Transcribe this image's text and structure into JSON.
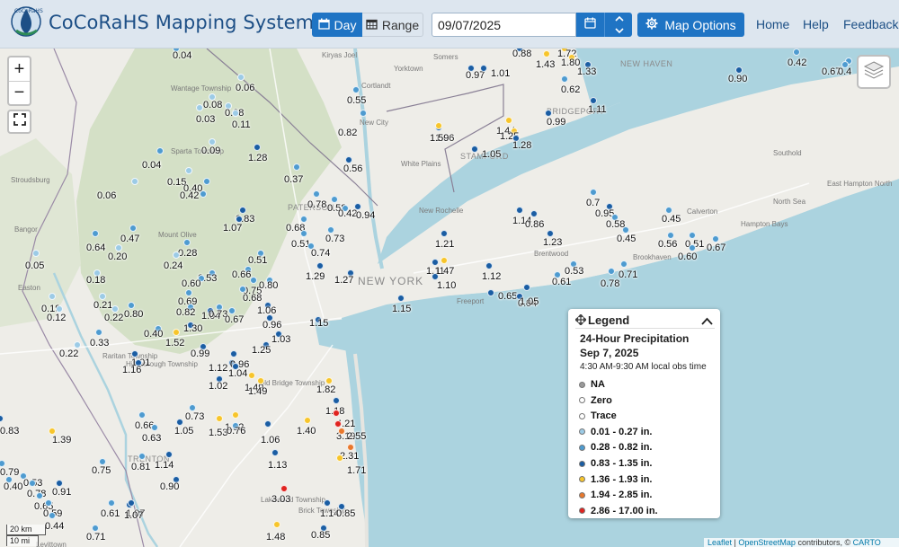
{
  "header": {
    "title": "CoCoRaHS Mapping System",
    "logo_text": "CoCoRaHS",
    "day_label": "Day",
    "range_label": "Range",
    "date_value": "09/07/2025",
    "map_options_label": "Map Options",
    "nav": [
      "Home",
      "Help",
      "Feedback"
    ]
  },
  "colors": {
    "accent": "#1f74c4",
    "water": "#abd3df",
    "land": "#eeede8",
    "county_green": "#d4e0c6",
    "na": "#9a9a9a",
    "zero": "#ffffff",
    "trace": "#ffffff",
    "bin1": "#9ccbe6",
    "bin2": "#4e9bd0",
    "bin3": "#1a5da3",
    "bin4": "#f7c52b",
    "bin5": "#e8782d",
    "bin6": "#e0231f"
  },
  "icons": {
    "day": "calendar-day-icon",
    "range": "calendar-range-icon",
    "calendar": "calendar-icon",
    "up": "chevron-up-icon",
    "down": "chevron-down-icon",
    "options": "gear-icon",
    "zoom_in": "plus-icon",
    "zoom_out": "minus-icon",
    "fullscreen": "fullscreen-icon",
    "layers": "layers-icon",
    "legend_move": "move-icon",
    "legend_collapse": "chevron-up-icon"
  },
  "map": {
    "zoom_in": "+",
    "zoom_out": "−",
    "place_labels": [
      "Kiryas Joel",
      "Yorktown",
      "Somers",
      "NEW HAVEN",
      "Cortlandt",
      "New City",
      "BRIDGEPORT",
      "STAMFORD",
      "White Plains",
      "Wantage Township",
      "Sparta Township",
      "Stroudsburg",
      "Bangor",
      "Mount Olive",
      "PATERSON",
      "New Rochelle",
      "NEW YORK",
      "Freeport",
      "Easton",
      "Raritan Township",
      "Hillsborough Township",
      "Old Bridge Township",
      "TRENTON",
      "Lakewood Township",
      "Brick Township",
      "Levittown",
      "Brentwood",
      "Brookhaven",
      "Calverton",
      "Southold",
      "North Sea",
      "East Hampton North",
      "Hampton Bays"
    ],
    "scale_km": "20 km",
    "scale_mi": "10 mi",
    "attribution": [
      "Leaflet",
      "OpenStreetMap",
      "contributors",
      "CARTO"
    ]
  },
  "stations": [
    {
      "v": "0.04",
      "c": 2
    },
    {
      "v": "0.06",
      "c": 1
    },
    {
      "v": "0.08",
      "c": 1
    },
    {
      "v": "0.03",
      "c": 1
    },
    {
      "v": "0.08",
      "c": 1
    },
    {
      "v": "0.11",
      "c": 1
    },
    {
      "v": "0.09",
      "c": 1
    },
    {
      "v": "0.04",
      "c": 2
    },
    {
      "v": "1.28",
      "c": 3
    },
    {
      "v": "0.15",
      "c": 1
    },
    {
      "v": "0.40",
      "c": 2
    },
    {
      "v": "0.42",
      "c": 2
    },
    {
      "v": "0.06",
      "c": 1
    },
    {
      "v": "0.37",
      "c": 2
    },
    {
      "v": "0.55",
      "c": 2
    },
    {
      "v": "0.82",
      "c": 2
    },
    {
      "v": "0.56",
      "c": 3
    },
    {
      "v": "0.83",
      "c": 3
    },
    {
      "v": "1.07",
      "c": 3
    },
    {
      "v": "0.78",
      "c": 2
    },
    {
      "v": "0.58",
      "c": 2
    },
    {
      "v": "0.42",
      "c": 2
    },
    {
      "v": "0.94",
      "c": 3
    },
    {
      "v": "0.68",
      "c": 2
    },
    {
      "v": "0.51",
      "c": 2
    },
    {
      "v": "0.73",
      "c": 2
    },
    {
      "v": "0.74",
      "c": 2
    },
    {
      "v": "0.64",
      "c": 2
    },
    {
      "v": "0.47",
      "c": 2
    },
    {
      "v": "0.20",
      "c": 1
    },
    {
      "v": "0.05",
      "c": 1
    },
    {
      "v": "0.28",
      "c": 2
    },
    {
      "v": "0.24",
      "c": 1
    },
    {
      "v": "0.18",
      "c": 1
    },
    {
      "v": "0.66",
      "c": 2
    },
    {
      "v": "0.51",
      "c": 2
    },
    {
      "v": "1.29",
      "c": 3
    },
    {
      "v": "1.27",
      "c": 3
    },
    {
      "v": "0.53",
      "c": 2
    },
    {
      "v": "0.60",
      "c": 2
    },
    {
      "v": "0.75",
      "c": 2
    },
    {
      "v": "0.80",
      "c": 2
    },
    {
      "v": "0.21",
      "c": 1
    },
    {
      "v": "0.22",
      "c": 1
    },
    {
      "v": "0.80",
      "c": 2
    },
    {
      "v": "0.69",
      "c": 2
    },
    {
      "v": "0.68",
      "c": 2
    },
    {
      "v": "0.19",
      "c": 1
    },
    {
      "v": "0.12",
      "c": 1
    },
    {
      "v": "0.82",
      "c": 2
    },
    {
      "v": "1.04",
      "c": 3
    },
    {
      "v": "0.73",
      "c": 2
    },
    {
      "v": "0.67",
      "c": 2
    },
    {
      "v": "1.06",
      "c": 3
    },
    {
      "v": "1.15",
      "c": 3
    },
    {
      "v": "0.96",
      "c": 3
    },
    {
      "v": "0.33",
      "c": 2
    },
    {
      "v": "0.40",
      "c": 2
    },
    {
      "v": "1.30",
      "c": 3
    },
    {
      "v": "1.52",
      "c": 4
    },
    {
      "v": "1.03",
      "c": 3
    },
    {
      "v": "0.22",
      "c": 1
    },
    {
      "v": "0.99",
      "c": 3
    },
    {
      "v": "1.25",
      "c": 3
    },
    {
      "v": "1.01",
      "c": 3
    },
    {
      "v": "1.16",
      "c": 3
    },
    {
      "v": "1.12",
      "c": 3
    },
    {
      "v": "0.96",
      "c": 3
    },
    {
      "v": "1.04",
      "c": 3
    },
    {
      "v": "1.02",
      "c": 3
    },
    {
      "v": "1.49",
      "c": 4
    },
    {
      "v": "1.49",
      "c": 4
    },
    {
      "v": "0.73",
      "c": 2
    },
    {
      "v": "0.66",
      "c": 2
    },
    {
      "v": "1.05",
      "c": 3
    },
    {
      "v": "0.63",
      "c": 2
    },
    {
      "v": "1.53",
      "c": 4
    },
    {
      "v": "1.52",
      "c": 4
    },
    {
      "v": "0.76",
      "c": 2
    },
    {
      "v": "1.06",
      "c": 3
    },
    {
      "v": "1.40",
      "c": 4
    },
    {
      "v": "1.82",
      "c": 4
    },
    {
      "v": "1.18",
      "c": 3
    },
    {
      "v": "4.21",
      "c": 6
    },
    {
      "v": "3.19",
      "c": 6
    },
    {
      "v": "2.55",
      "c": 5
    },
    {
      "v": "2.31",
      "c": 5
    },
    {
      "v": "1.71",
      "c": 4
    },
    {
      "v": "1.13",
      "c": 3
    },
    {
      "v": "1.14",
      "c": 3
    },
    {
      "v": "0.81",
      "c": 2
    },
    {
      "v": "0.75",
      "c": 2
    },
    {
      "v": "0.90",
      "c": 3
    },
    {
      "v": "1.07",
      "c": 3
    },
    {
      "v": "0.83",
      "c": 3
    },
    {
      "v": "1.39",
      "c": 4
    },
    {
      "v": "0.79",
      "c": 2
    },
    {
      "v": "0.53",
      "c": 2
    },
    {
      "v": "0.40",
      "c": 2
    },
    {
      "v": "0.78",
      "c": 2
    },
    {
      "v": "0.91",
      "c": 3
    },
    {
      "v": "0.65",
      "c": 2
    },
    {
      "v": "0.59",
      "c": 2
    },
    {
      "v": "0.44",
      "c": 2
    },
    {
      "v": "0.61",
      "c": 2
    },
    {
      "v": "1.07",
      "c": 3
    },
    {
      "v": "0.71",
      "c": 2
    },
    {
      "v": "3.03",
      "c": 6
    },
    {
      "v": "1.48",
      "c": 4
    },
    {
      "v": "1.14",
      "c": 3
    },
    {
      "v": "0.85",
      "c": 3
    },
    {
      "v": "0.85",
      "c": 3
    },
    {
      "v": "0.88",
      "c": 3
    },
    {
      "v": "1.72",
      "c": 4
    },
    {
      "v": "1.43",
      "c": 4
    },
    {
      "v": "1.80",
      "c": 4
    },
    {
      "v": "1.33",
      "c": 3
    },
    {
      "v": "0.97",
      "c": 3
    },
    {
      "v": "1.01",
      "c": 3
    },
    {
      "v": "0.62",
      "c": 2
    },
    {
      "v": "1.11",
      "c": 3
    },
    {
      "v": "0.99",
      "c": 3
    },
    {
      "v": "1.44",
      "c": 4
    },
    {
      "v": "1.25",
      "c": 4
    },
    {
      "v": "1.28",
      "c": 3
    },
    {
      "v": "1.06",
      "c": 3
    },
    {
      "v": "1.59",
      "c": 4
    },
    {
      "v": "1.05",
      "c": 3
    },
    {
      "v": "0.42",
      "c": 2
    },
    {
      "v": "0.67",
      "c": 2
    },
    {
      "v": "0.4",
      "c": 2
    },
    {
      "v": "0.90",
      "c": 3
    },
    {
      "v": "1.21",
      "c": 3
    },
    {
      "v": "1.11",
      "c": 3
    },
    {
      "v": "1.47",
      "c": 4
    },
    {
      "v": "1.10",
      "c": 3
    },
    {
      "v": "1.15",
      "c": 3
    },
    {
      "v": "1.12",
      "c": 3
    },
    {
      "v": "0.65",
      "c": 3
    },
    {
      "v": "0.94",
      "c": 3
    },
    {
      "v": "1.05",
      "c": 3
    },
    {
      "v": "1.14",
      "c": 3
    },
    {
      "v": "0.86",
      "c": 3
    },
    {
      "v": "1.23",
      "c": 3
    },
    {
      "v": "0.53",
      "c": 2
    },
    {
      "v": "0.61",
      "c": 2
    },
    {
      "v": "0.78",
      "c": 2
    },
    {
      "v": "0.71",
      "c": 2
    },
    {
      "v": "0.7",
      "c": 2
    },
    {
      "v": "0.95",
      "c": 3
    },
    {
      "v": "0.58",
      "c": 2
    },
    {
      "v": "0.45",
      "c": 2
    },
    {
      "v": "0.45",
      "c": 2
    },
    {
      "v": "0.56",
      "c": 2
    },
    {
      "v": "0.51",
      "c": 2
    },
    {
      "v": "0.60",
      "c": 2
    },
    {
      "v": "0.67",
      "c": 2
    }
  ],
  "legend": {
    "title": "Legend",
    "heading": "24-Hour Precipitation",
    "date": "Sep 7, 2025",
    "obs_time": "4:30 AM-9:30 AM local obs time",
    "items": [
      {
        "label": "NA",
        "color": "#9a9a9a"
      },
      {
        "label": "Zero",
        "color": "#ffffff"
      },
      {
        "label": "Trace",
        "color": "#ffffff"
      },
      {
        "label": "0.01 - 0.27 in.",
        "color": "#9ccbe6"
      },
      {
        "label": "0.28 - 0.82 in.",
        "color": "#4e9bd0"
      },
      {
        "label": "0.83 - 1.35 in.",
        "color": "#1a5da3"
      },
      {
        "label": "1.36 - 1.93 in.",
        "color": "#f7c52b"
      },
      {
        "label": "1.94 - 2.85 in.",
        "color": "#e8782d"
      },
      {
        "label": "2.86 - 17.00 in.",
        "color": "#e0231f"
      }
    ]
  }
}
